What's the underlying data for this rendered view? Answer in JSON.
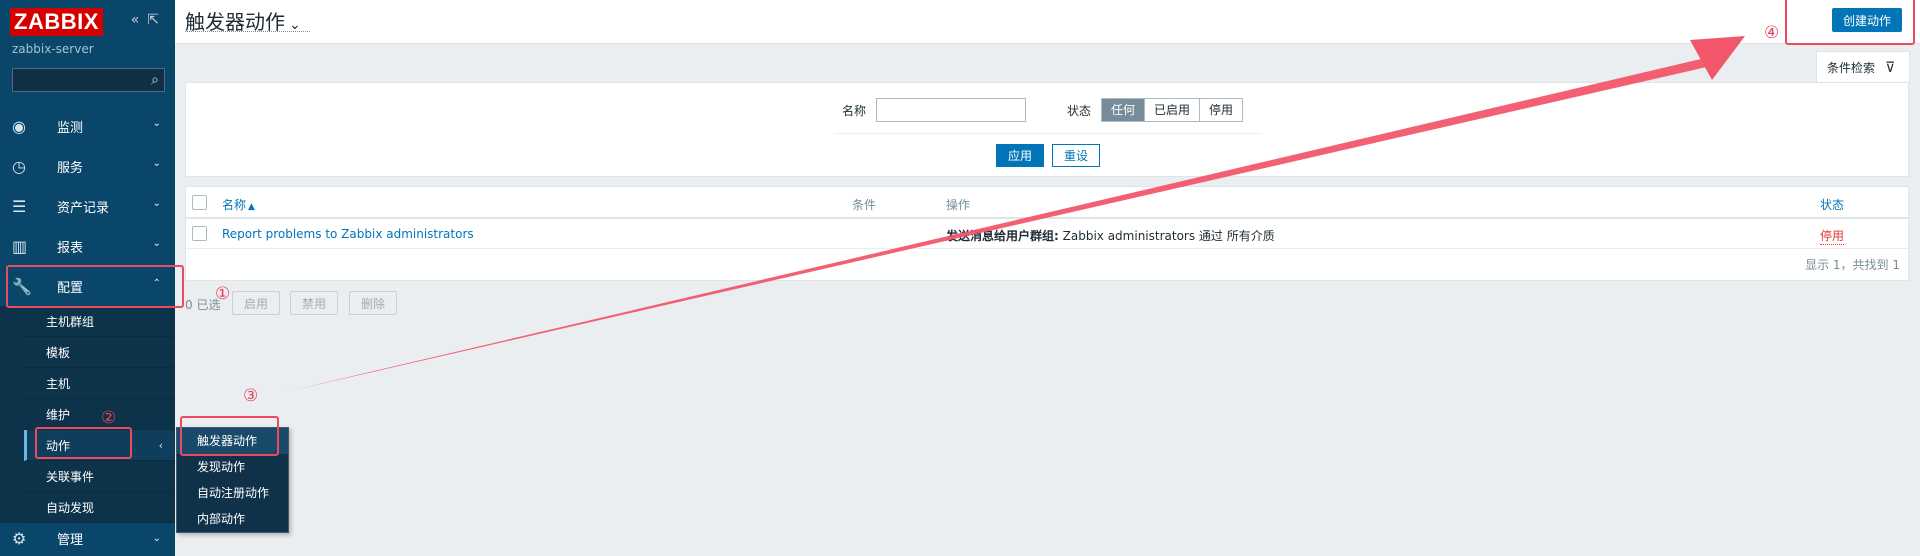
{
  "sidebar": {
    "logo": "ZABBIX",
    "server": "zabbix-server",
    "search_placeholder": "",
    "menu": [
      {
        "label": "监测",
        "icon": "eye-icon"
      },
      {
        "label": "服务",
        "icon": "clock-icon"
      },
      {
        "label": "资产记录",
        "icon": "list-icon"
      },
      {
        "label": "报表",
        "icon": "chart-icon"
      },
      {
        "label": "配置",
        "icon": "wrench-icon"
      }
    ],
    "config_items": [
      "主机群组",
      "模板",
      "主机",
      "维护",
      "动作",
      "关联事件",
      "自动发现"
    ],
    "admin": "管理"
  },
  "flyout": [
    "触发器动作",
    "发现动作",
    "自动注册动作",
    "内部动作"
  ],
  "header": {
    "title": "触发器动作",
    "create_button": "创建动作"
  },
  "filter": {
    "tab_label": "条件检索",
    "name_label": "名称",
    "name_value": "",
    "status_label": "状态",
    "status_options": [
      "任何",
      "已启用",
      "停用"
    ],
    "status_selected": "任何",
    "apply": "应用",
    "reset": "重设"
  },
  "table": {
    "headers": {
      "name": "名称",
      "sort_arrow": "▲",
      "conditions": "条件",
      "operations": "操作",
      "status": "状态"
    },
    "rows": [
      {
        "name": "Report problems to Zabbix administrators",
        "conditions": "",
        "op_bold": "发送消息给用户群组:",
        "op_text": "Zabbix administrators 通过 所有介质",
        "status": "停用"
      }
    ],
    "footer": "显示 1，共找到 1"
  },
  "actions": {
    "selected": "0 已选",
    "enable": "启用",
    "disable": "禁用",
    "delete": "删除"
  },
  "annotations": {
    "n1": "①",
    "n2": "②",
    "n3": "③",
    "n4": "④",
    "color": "#ee4a5f"
  }
}
